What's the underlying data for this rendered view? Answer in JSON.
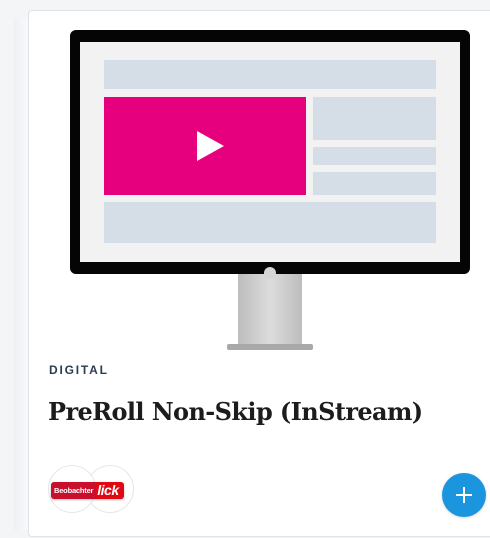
{
  "card": {
    "category": "DIGITAL",
    "title": "PreRoll Non-Skip (InStream)",
    "illustration_icon": "monitor-with-video-player-icon",
    "play_icon": "play-icon"
  },
  "publishers": {
    "logo_left_text": "Beobachter",
    "logo_right_text": "lick"
  },
  "actions": {
    "add_icon": "plus-icon"
  },
  "colors": {
    "accent_magenta": "#e6007e",
    "placeholder_blocks": "#d5dee6",
    "monitor_frame": "#000000",
    "stand": "#c9c9c9",
    "add_button": "#1b95dd",
    "category_text": "#2b3d50",
    "logo_red": "#e30613"
  }
}
